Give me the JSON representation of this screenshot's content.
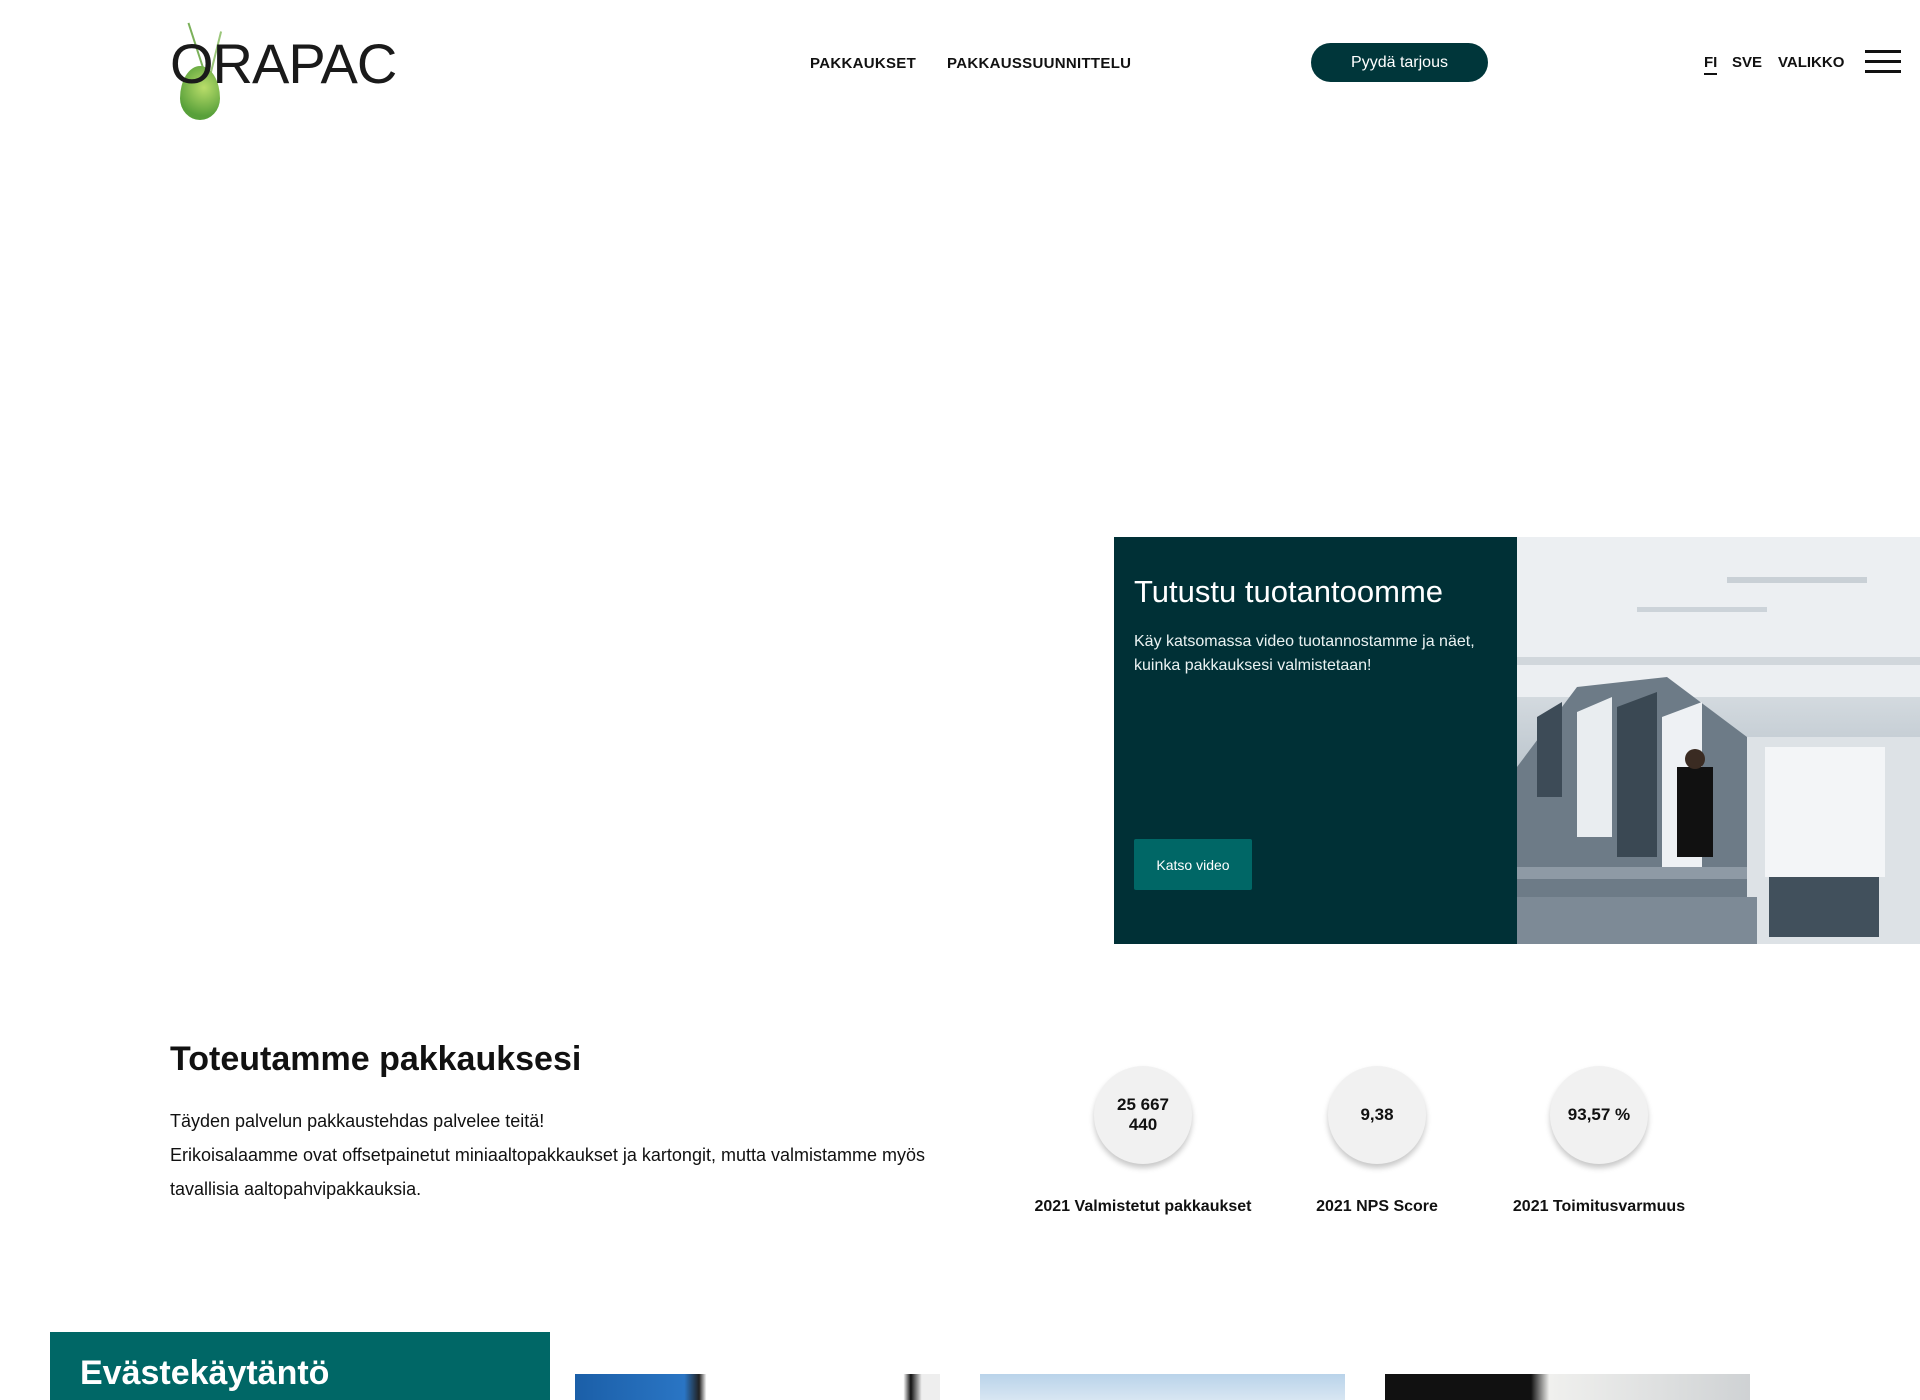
{
  "header": {
    "logo_text": "ORAPAC",
    "nav": [
      "PAKKAUKSET",
      "PAKKAUSSUUNNITTELU"
    ],
    "cta_label": "Pyydä tarjous",
    "languages": [
      "FI",
      "SVE"
    ],
    "menu_label": "VALIKKO"
  },
  "video_section": {
    "title": "Tutustu tuotantoomme",
    "description": "Käy katsomassa video tuotannostamme ja näet, kuinka pakkauksesi valmistetaan!",
    "button_label": "Katso video"
  },
  "intro": {
    "title": "Toteutamme pakkauksesi",
    "line1": "Täyden palvelun pakkaustehdas palvelee teitä!",
    "line2": "Erikoisalaamme ovat offsetpainetut miniaaltopakkaukset ja kartongit, mutta valmistamme myös tavallisia aaltopahvipakkauksia."
  },
  "stats": [
    {
      "value": "25 667 440",
      "label": "2021 Valmistetut pakkaukset"
    },
    {
      "value": "9,38",
      "label": "2021 NPS Score"
    },
    {
      "value": "93,57 %",
      "label": "2021 Toimitusvarmuus"
    }
  ],
  "cookie_banner": {
    "title": "Evästekäytäntö"
  },
  "colors": {
    "dark_teal": "#00363a",
    "teal": "#006766"
  }
}
